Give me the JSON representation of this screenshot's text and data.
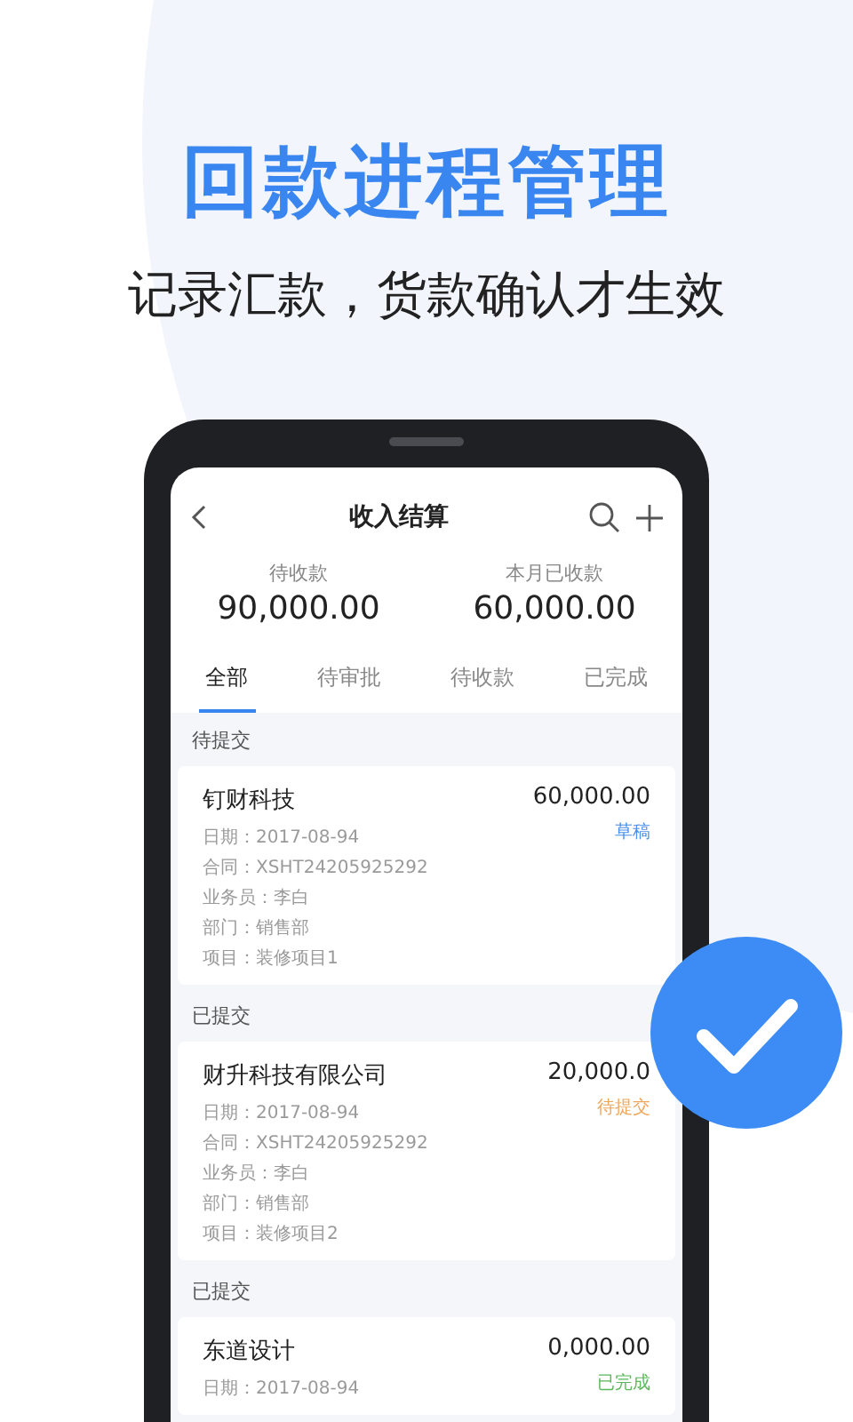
{
  "headline": "回款进程管理",
  "subtitle": "记录汇款，货款确认才生效",
  "app": {
    "title": "收入结算",
    "stats": [
      {
        "label": "待收款",
        "value": "90,000.00"
      },
      {
        "label": "本月已收款",
        "value": "60,000.00"
      }
    ],
    "tabs": [
      {
        "label": "全部",
        "selected": true
      },
      {
        "label": "待审批",
        "selected": false
      },
      {
        "label": "待收款",
        "selected": false
      },
      {
        "label": "已完成",
        "selected": false
      }
    ],
    "sections": [
      {
        "header": "待提交",
        "card": {
          "name": "钉财科技",
          "amount": "60,000.00",
          "status": "草稿",
          "color": "#4a8fe8",
          "details": [
            "日期：2017-08-94",
            "合同：XSHT24205925292",
            "业务员：李白",
            "部门：销售部",
            "项目：装修项目1"
          ]
        }
      },
      {
        "header": "已提交",
        "card": {
          "name": "财升科技有限公司",
          "amount": "20,000.0",
          "status": "待提交",
          "color": "#f0a65a",
          "details": [
            "日期：2017-08-94",
            "合同：XSHT24205925292",
            "业务员：李白",
            "部门：销售部",
            "项目：装修项目2"
          ]
        }
      },
      {
        "header": "已提交",
        "card": {
          "name": "东道设计",
          "amount": "0,000.00",
          "status": "已完成",
          "color": "#5cb85c",
          "details": [
            "日期：2017-08-94"
          ]
        }
      }
    ]
  }
}
